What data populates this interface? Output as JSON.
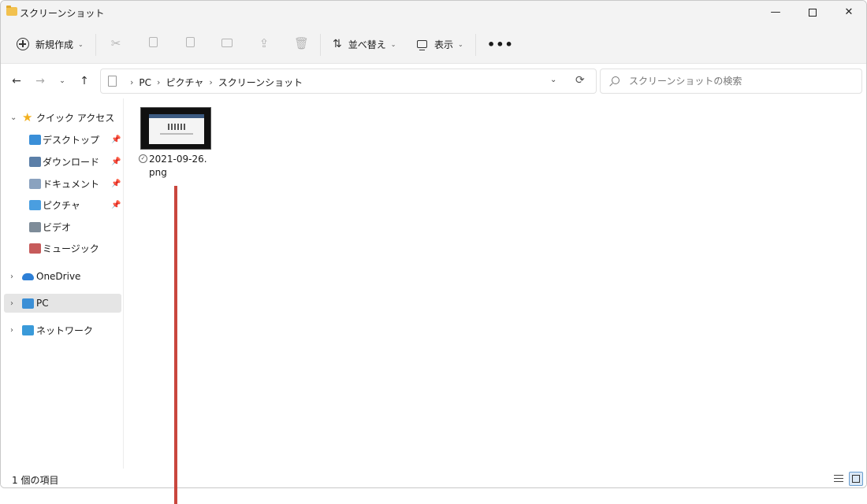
{
  "window": {
    "title": "スクリーンショット"
  },
  "toolbar": {
    "new_label": "新規作成",
    "sort_label": "並べ替え",
    "view_label": "表示",
    "more_label": "•••"
  },
  "address": {
    "crumbs": [
      "PC",
      "ピクチャ",
      "スクリーンショット"
    ]
  },
  "search": {
    "placeholder": "スクリーンショットの検索"
  },
  "sidebar": {
    "quick_access": "クイック アクセス",
    "items": [
      {
        "label": "デスクトップ",
        "icon": "desktop-folder-icon",
        "pinned": true
      },
      {
        "label": "ダウンロード",
        "icon": "downloads-folder-icon",
        "pinned": true
      },
      {
        "label": "ドキュメント",
        "icon": "documents-folder-icon",
        "pinned": true
      },
      {
        "label": "ピクチャ",
        "icon": "pictures-folder-icon",
        "pinned": true
      },
      {
        "label": "ビデオ",
        "icon": "videos-folder-icon",
        "pinned": false
      },
      {
        "label": "ミュージック",
        "icon": "music-folder-icon",
        "pinned": false
      }
    ],
    "onedrive": "OneDrive",
    "pc": "PC",
    "network": "ネットワーク"
  },
  "files": [
    {
      "name": "2021-09-26.png",
      "status": "synced"
    }
  ],
  "status": {
    "item_count": "1 個の項目"
  },
  "colors": {
    "accent": "#3b8fd6",
    "callout": "#c9463d",
    "folder": "#f2c14e"
  }
}
